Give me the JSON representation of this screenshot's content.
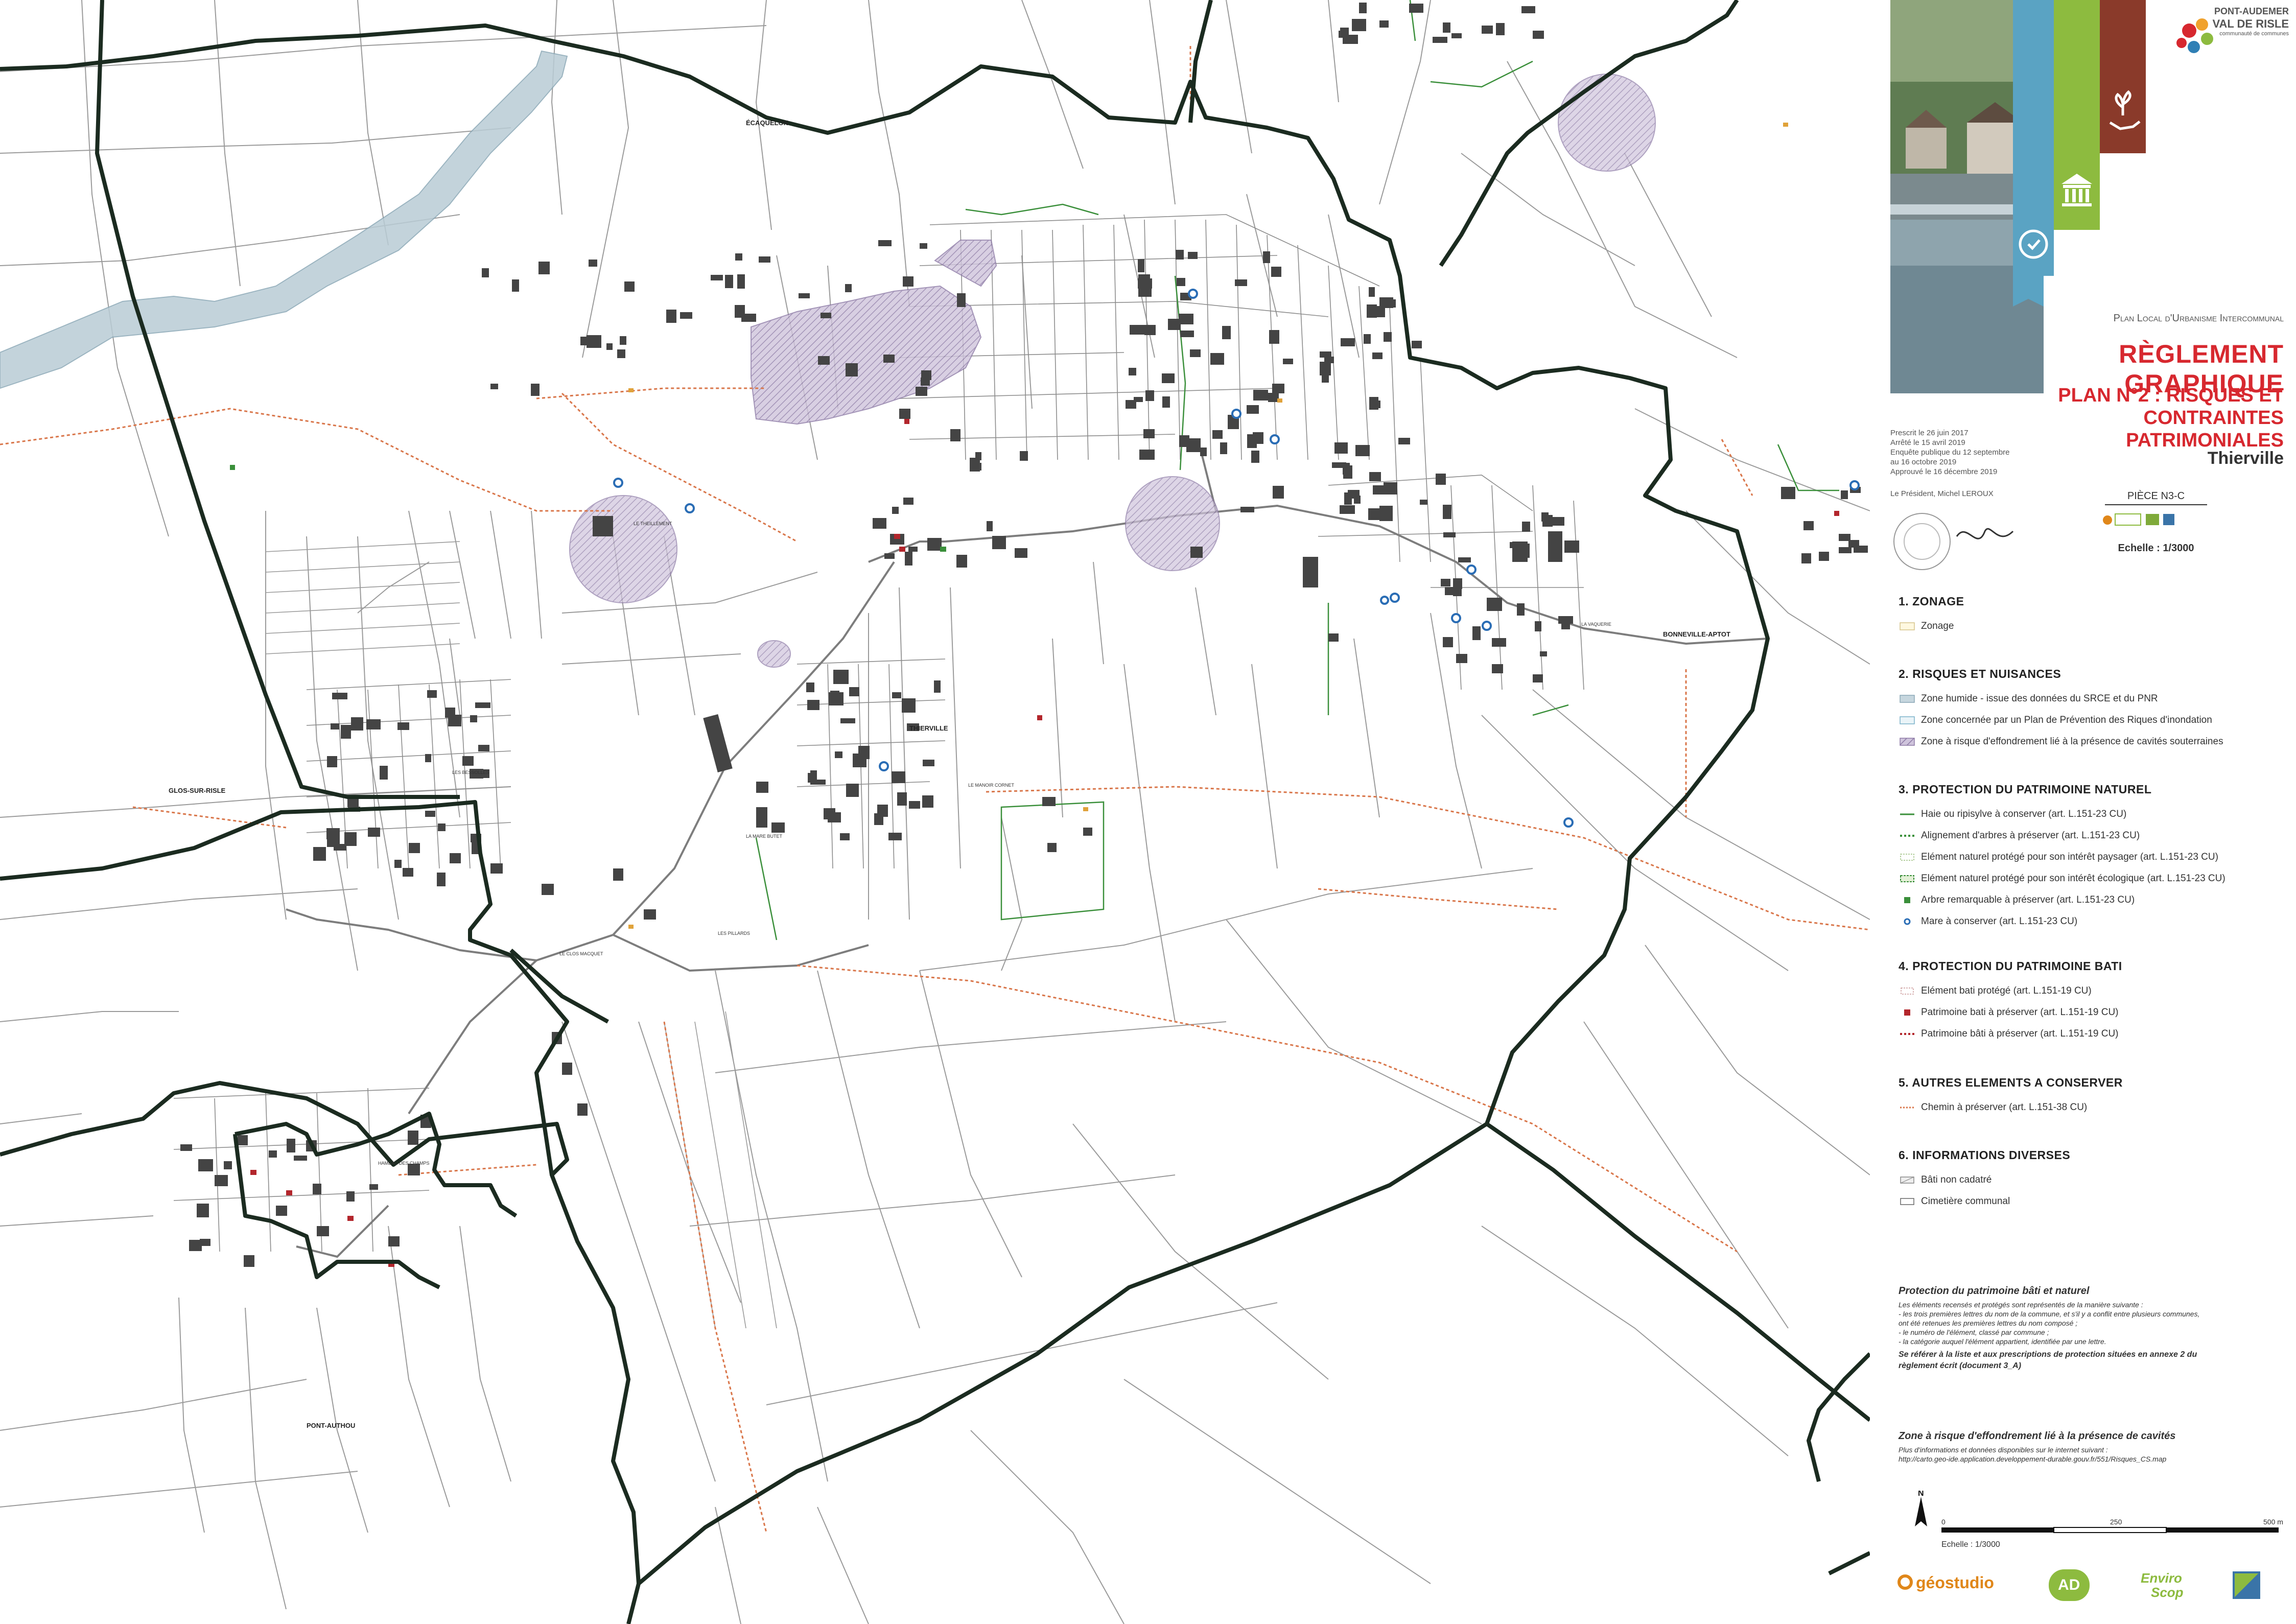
{
  "map": {
    "places": {
      "ecaquelon": "ÉCAQUELON",
      "thierville": "THIERVILLE",
      "glos": "GLOS-SUR-RISLE",
      "bonneville": "BONNEVILLE-APTOT",
      "pont_authou": "PONT-AUTHOU",
      "le_theillement": "LE THEILLEMENT",
      "la_vaquerie": "LA VAQUERIE",
      "les_bessolles": "LES BESSOLLES",
      "la_mare_butet": "LA MARE BUTET",
      "le_manoir_cornet": "LE MANOIR CORNET",
      "le_clos_macquet": "LE CLOS MACQUET",
      "les_pillards": "LES PILLARDS",
      "hameau_des_champs": "HAMEAU DES CHAMPS"
    },
    "colors": {
      "commune_border": "#1b2b20",
      "hedge": "#3a8f3a",
      "chemin": "#d9764a",
      "wetland": "#9fb8c6",
      "risk_zone": "#8d7aa6",
      "mare": "#2a6db5",
      "building": "#444444",
      "patrimoine": "#b3262c"
    }
  },
  "cover": {
    "brand_line1": "PONT-AUDEMER",
    "brand_line2": "VAL DE RISLE",
    "brand_line3": "communauté de communes",
    "title_small": "Plan Local d'Urbanisme Intercommunal",
    "title_large": "RÈGLEMENT GRAPHIQUE",
    "title_plan_1": "PLAN N°2 : RISQUES ET",
    "title_plan_2": "CONTRAINTES PATRIMONIALES",
    "commune": "Thierville",
    "piece": "PIÈCE N3-C",
    "echelle": "Echelle : 1/3000",
    "dates": [
      "Prescrit le 26 juin 2017",
      "Arrêté le 15 avril 2019",
      "Enquête publique du 12 septembre",
      "au 16 octobre 2019",
      "Approuvé le 16 décembre 2019"
    ],
    "president": "Le Président, Michel LEROUX",
    "colors": {
      "band_blue": "#5aa3c3",
      "band_green": "#8dbb3f",
      "band_brown": "#8a3a2a",
      "title_red": "#d7282f"
    },
    "icons": [
      "lightbulb-head-icon",
      "building-icon",
      "hand-plant-icon"
    ]
  },
  "legend": {
    "s1": {
      "title": "1. ZONAGE",
      "items": [
        "Zonage"
      ]
    },
    "s2": {
      "title": "2. RISQUES ET NUISANCES",
      "items": [
        "Zone humide - issue des données du SRCE et du PNR",
        "Zone concernée par un Plan de Prévention des Riques d'inondation",
        "Zone à risque d'effondrement lié à la présence de cavités souterraines"
      ]
    },
    "s3": {
      "title": "3. PROTECTION DU PATRIMOINE NATUREL",
      "items": [
        "Haie ou ripisylve à conserver (art. L.151-23 CU)",
        "Alignement d'arbres à préserver (art. L.151-23 CU)",
        "Elément naturel protégé pour son intérêt paysager (art. L.151-23 CU)",
        "Elément naturel protégé pour son intérêt écologique (art. L.151-23 CU)",
        "Arbre remarquable à préserver (art. L.151-23 CU)",
        "Mare à conserver (art. L.151-23 CU)"
      ]
    },
    "s4": {
      "title": "4. PROTECTION DU PATRIMOINE BATI",
      "items": [
        "Elément bati protégé (art. L.151-19 CU)",
        "Patrimoine bati à préserver (art. L.151-19 CU)",
        "Patrimoine bâti à préserver (art. L.151-19 CU)"
      ]
    },
    "s5": {
      "title": "5. AUTRES ELEMENTS A CONSERVER",
      "items": [
        "Chemin à préserver  (art. L.151-38 CU)"
      ]
    },
    "s6": {
      "title": "6. INFORMATIONS DIVERSES",
      "items": [
        "Bâti non cadatré",
        "Cimetière communal"
      ]
    }
  },
  "notes": {
    "protection_title": "Protection du patrimoine bâti et naturel",
    "protection_lines": [
      "Les éléments recensés et protégés sont représentés de la manière suivante :",
      "- les trois premières lettres du nom de la commune, et s'il y a conflit entre plusieurs communes,",
      "ont été retenues les premières lettres du nom composé ;",
      "- le numéro de l'élément, classé par commune ;",
      "- la catégorie auquel l'élément appartient, identifiée par une lettre."
    ],
    "protection_ref_1": "Se référer à la liste et aux prescriptions de protection situées en annexe 2 du",
    "protection_ref_2": "règlement écrit (document 3_A)",
    "zone_title": "Zone à risque d'effondrement lié à la présence de cavités",
    "zone_line1": "Plus d'informations et données disponibles sur le internet suivant :",
    "zone_line2": "http://carto.geo-ide.application.developpement-durable.gouv.fr/551/Risques_CS.map"
  },
  "scale": {
    "north": "N",
    "t0": "0",
    "t1": "250",
    "t2": "500 m",
    "label": "Echelle : 1/3000"
  },
  "logos": {
    "geostudio": "géostudio",
    "ad": "AD",
    "envirosc_1": "Enviro",
    "envirosc_2": "Scop"
  }
}
